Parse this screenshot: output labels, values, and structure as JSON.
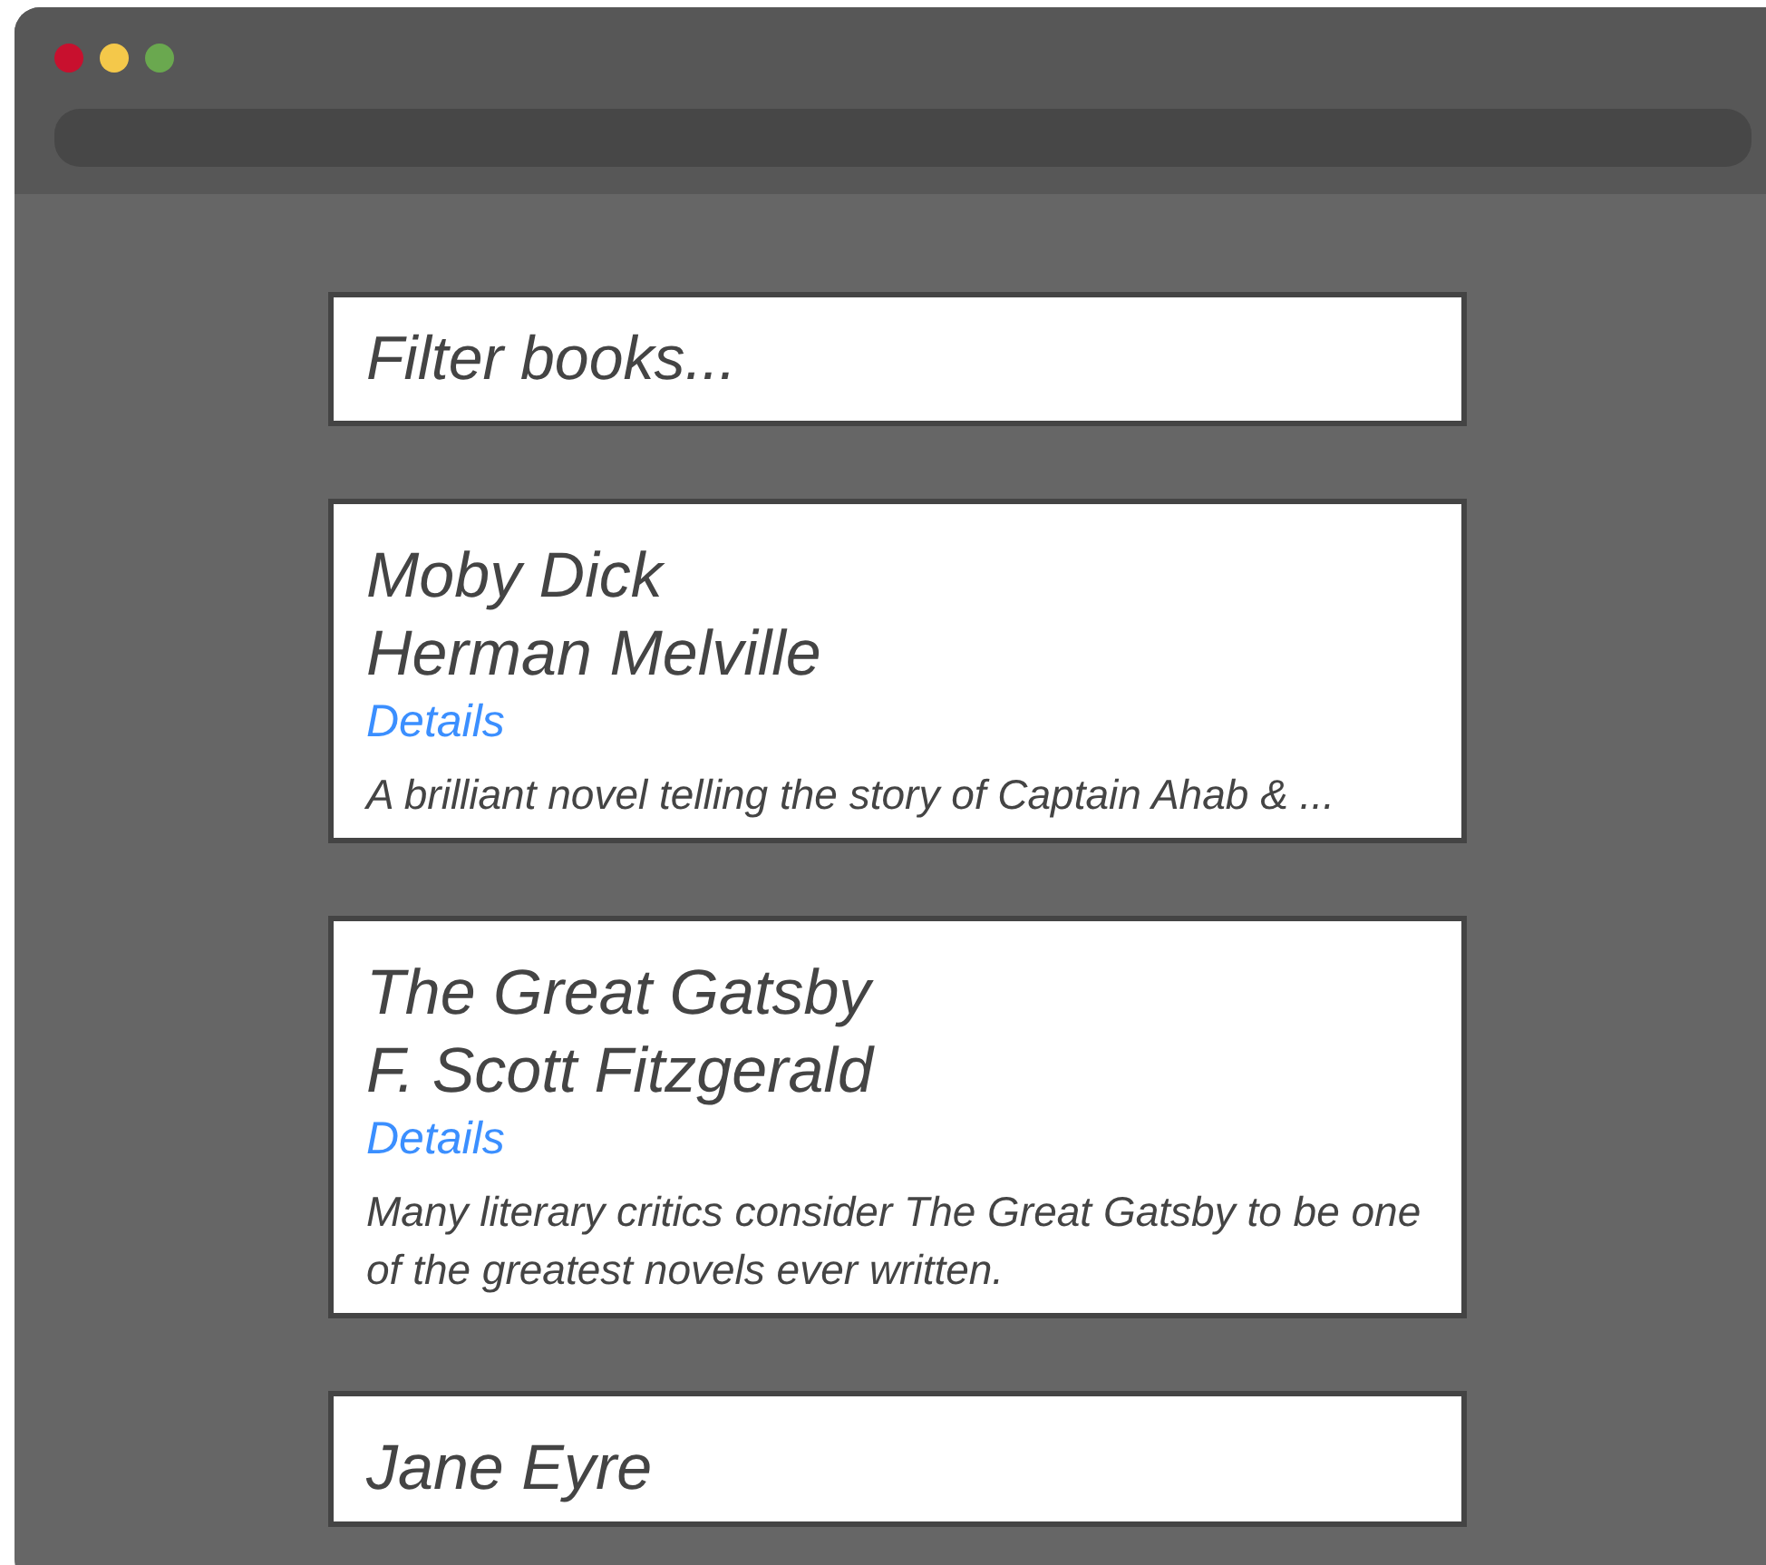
{
  "search": {
    "placeholder": "Filter books..."
  },
  "books": [
    {
      "title": "Moby Dick",
      "author": "Herman Melville",
      "link": "Details",
      "description": "A brilliant novel telling the story of Captain Ahab & ..."
    },
    {
      "title": "The Great Gatsby",
      "author": "F. Scott Fitzgerald",
      "link": "Details",
      "description": "Many literary critics consider The Great Gatsby to be one of the greatest novels ever written."
    },
    {
      "title": "Jane Eyre"
    }
  ]
}
